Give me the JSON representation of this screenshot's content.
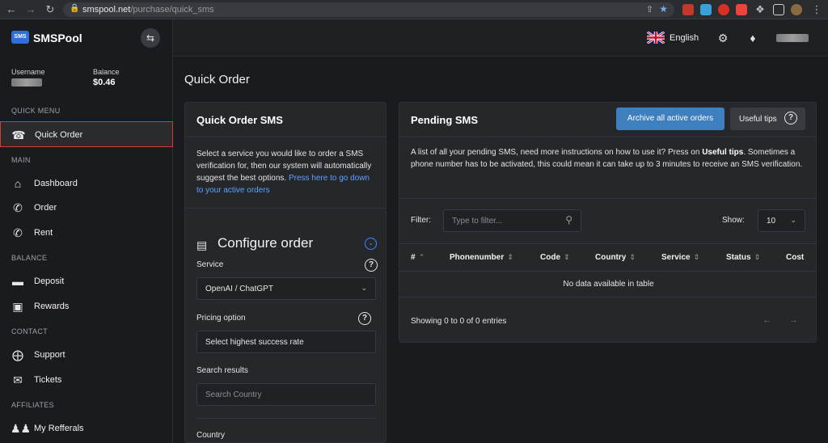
{
  "browser": {
    "url_host": "smspool.net",
    "url_path": "/purchase/quick_sms"
  },
  "brand": {
    "logo_text": "SMS",
    "name": "SMSPool"
  },
  "account": {
    "username_label": "Username",
    "balance_label": "Balance",
    "balance_value": "$0.46"
  },
  "sidebar": {
    "sections": [
      {
        "label": "QUICK MENU",
        "items": [
          {
            "label": "Quick Order",
            "icon": "phone-icon",
            "active": true
          }
        ]
      },
      {
        "label": "MAIN",
        "items": [
          {
            "label": "Dashboard",
            "icon": "home-icon"
          },
          {
            "label": "Order",
            "icon": "phone-call-icon"
          },
          {
            "label": "Rent",
            "icon": "phone-pin-icon"
          }
        ]
      },
      {
        "label": "BALANCE",
        "items": [
          {
            "label": "Deposit",
            "icon": "credit-card-icon"
          },
          {
            "label": "Rewards",
            "icon": "gift-icon"
          }
        ]
      },
      {
        "label": "CONTACT",
        "items": [
          {
            "label": "Support",
            "icon": "lifebuoy-icon"
          },
          {
            "label": "Tickets",
            "icon": "ticket-icon"
          }
        ]
      },
      {
        "label": "AFFILIATES",
        "items": [
          {
            "label": "My Refferals",
            "icon": "users-icon"
          }
        ]
      }
    ]
  },
  "header": {
    "language": "English"
  },
  "main": {
    "page_title": "Quick Order",
    "quick_order": {
      "title": "Quick Order SMS",
      "intro": "Select a service you would like to order a SMS verification for, then our system will automatically suggest the best options.",
      "intro_link": "Press here to go down to your active orders",
      "configure_title": "Configure order",
      "service_label": "Service",
      "service_value": "OpenAI / ChatGPT",
      "pricing_label": "Pricing option",
      "pricing_value": "Select highest success rate",
      "search_label": "Search results",
      "search_placeholder": "Search Country",
      "country_label": "Country"
    },
    "pending": {
      "title": "Pending SMS",
      "archive_button": "Archive all active orders",
      "tips_button": "Useful tips",
      "desc_pre": "A list of all your pending SMS, need more instructions on how to use it? Press on ",
      "desc_bold": "Useful tips",
      "desc_post": ". Sometimes a phone number has to be activated, this could mean it can take up to 3 minutes to receive an SMS verification.",
      "filter_label": "Filter:",
      "filter_placeholder": "Type to filter...",
      "show_label": "Show:",
      "show_value": "10",
      "columns": [
        "#",
        "Phonenumber",
        "Code",
        "Country",
        "Service",
        "Status",
        "Cost"
      ],
      "empty_text": "No data available in table",
      "showing_text": "Showing 0 to 0 of 0 entries"
    }
  }
}
